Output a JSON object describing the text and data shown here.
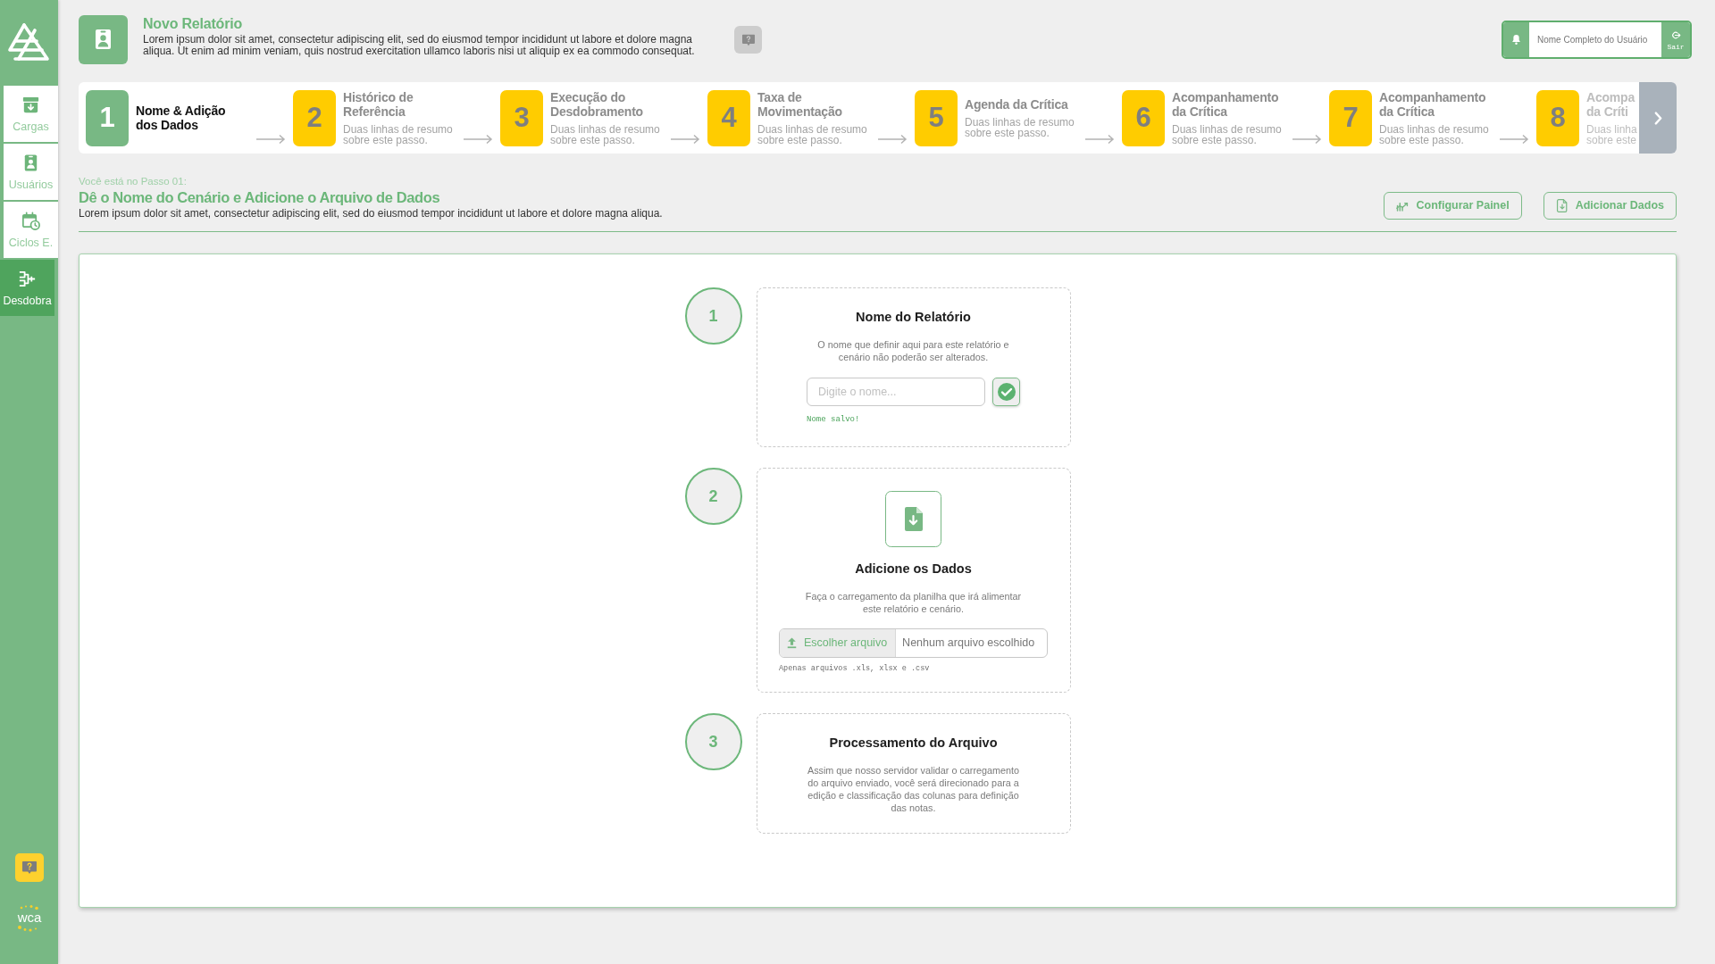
{
  "sidebar": {
    "items": [
      {
        "label": "Cargas",
        "selected": false
      },
      {
        "label": "Usuários",
        "selected": false
      },
      {
        "label": "Ciclos E.",
        "selected": false
      },
      {
        "label": "Desdobra",
        "selected": true
      }
    ],
    "brand": "wca"
  },
  "header": {
    "title": "Novo Relatório",
    "description": "Lorem ipsum dolor sit amet, consectetur adipiscing elit, sed do eiusmod tempor incididunt ut labore et dolore magna aliqua. Ut enim ad minim veniam, quis nostrud exercitation ullamco laboris nisi ut aliquip ex ea commodo consequat."
  },
  "user": {
    "name": "Nome Completo do Usuário",
    "logout": "Sair"
  },
  "steps": [
    {
      "number": "1",
      "title": "Nome & Adição\ndos Dados",
      "selected": true
    },
    {
      "number": "2",
      "title": "Histórico de\nReferência",
      "summary": "Duas linhas de resumo sobre este passo.",
      "selected": false
    },
    {
      "number": "3",
      "title": "Execução do\nDesdobramento",
      "summary": "Duas linhas de resumo sobre este passo.",
      "selected": false
    },
    {
      "number": "4",
      "title": "Taxa de\nMovimentação",
      "summary": "Duas linhas de resumo sobre este passo.",
      "selected": false
    },
    {
      "number": "5",
      "title": "Agenda da Crítica",
      "summary": "Duas linhas de resumo sobre este passo.",
      "selected": false
    },
    {
      "number": "6",
      "title": "Acompanhamento\nda Crítica",
      "summary": "Duas linhas de resumo sobre este passo.",
      "selected": false
    },
    {
      "number": "7",
      "title": "Acompanhamento\nda Crítica",
      "summary": "Duas linhas de resumo sobre este passo.",
      "selected": false
    },
    {
      "number": "8",
      "title": "Acompa\nda Críti",
      "summary": "Duas linha\nsobre este",
      "selected": false
    }
  ],
  "page": {
    "eyebrow": "Você está no Passo 01:",
    "title": "Dê o Nome do Cenário e Adicione o Arquivo de Dados",
    "description": "Lorem ipsum dolor sit amet, consectetur adipiscing elit, sed do eiusmod tempor incididunt ut labore et dolore magna aliqua.",
    "buttons": [
      {
        "label": "Configurar Painel"
      },
      {
        "label": "Adicionar Dados"
      }
    ]
  },
  "tasks": [
    {
      "number": "1",
      "kind": "name",
      "title": "Nome do Relatório",
      "text": "O nome que definir aqui para este relatório e cenário não poderão ser alterados.",
      "input": {
        "placeholder": "Digite o nome..."
      },
      "status": "Nome salvo!"
    },
    {
      "number": "2",
      "kind": "upload",
      "title": "Adicione os Dados",
      "text": "Faça o carregamento da planilha que irá alimentar este relatório e cenário.",
      "file": {
        "button": "Escolher arquivo",
        "status": "Nenhum arquivo escolhido"
      },
      "hint": "Apenas arquivos .xls, xlsx e .csv"
    },
    {
      "number": "3",
      "kind": "info",
      "title": "Processamento do Arquivo",
      "text": "Assim que nosso servidor validar o carregamento do arquivo enviado, você será direcionado para a edição e classificação das colunas para definição das notas."
    }
  ]
}
